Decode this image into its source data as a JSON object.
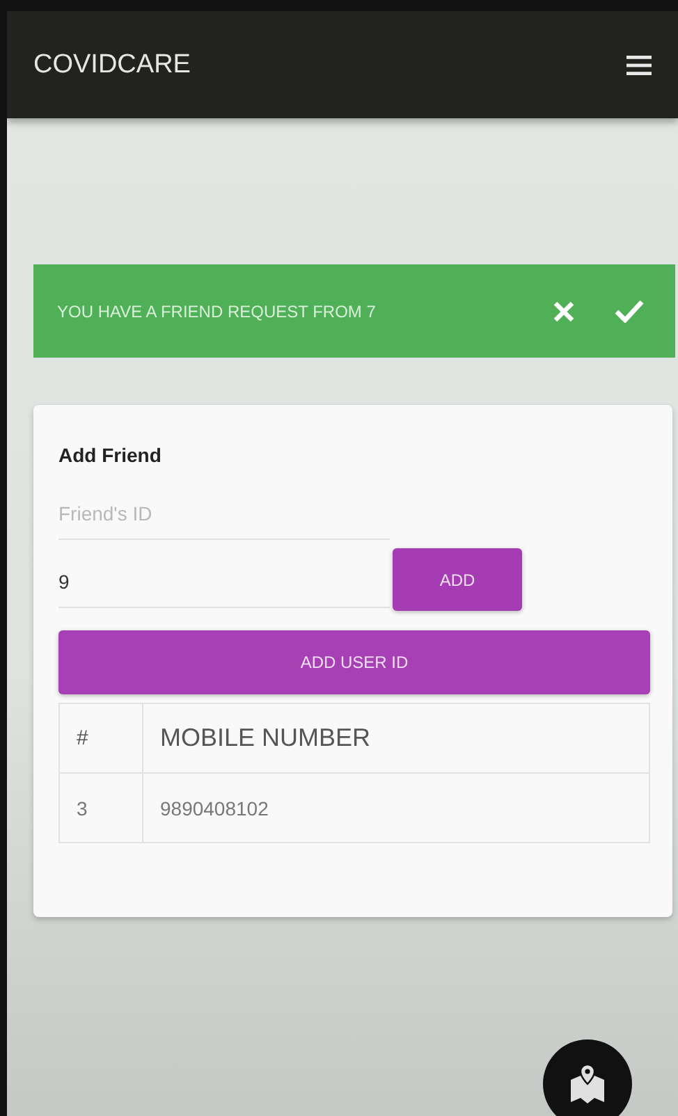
{
  "app_bar": {
    "title": "COVIDCARE"
  },
  "notification": {
    "text": "YOU HAVE A FRIEND REQUEST FROM 7"
  },
  "card": {
    "title": "Add Friend",
    "fields": [
      {
        "placeholder": "Friend's ID"
      },
      {
        "value": "9"
      }
    ],
    "add_button": "ADD",
    "add_user_id_button": "ADD USER ID",
    "table": {
      "columns": [
        "#",
        "MOBILE NUMBER"
      ],
      "rows": [
        [
          "3",
          "9890408102"
        ]
      ]
    }
  }
}
